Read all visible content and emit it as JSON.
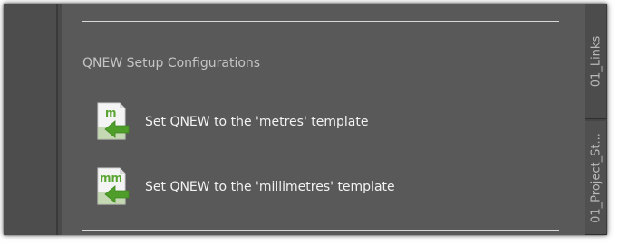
{
  "palette": {
    "section_title": "QNEW Setup Configurations",
    "commands": [
      {
        "label": "Set QNEW to the 'metres' template",
        "icon": "template-m-icon",
        "icon_text": "m"
      },
      {
        "label": "Set QNEW to the 'millimetres' template",
        "icon": "template-mm-icon",
        "icon_text": "mm"
      }
    ]
  },
  "tabs": [
    {
      "label": "01_Links"
    },
    {
      "label": "01_Project_St..."
    }
  ],
  "colors": {
    "background": "#595959",
    "accent_green": "#5aa532",
    "text": "#f2f2f2",
    "muted_text": "#c4c4c4"
  }
}
